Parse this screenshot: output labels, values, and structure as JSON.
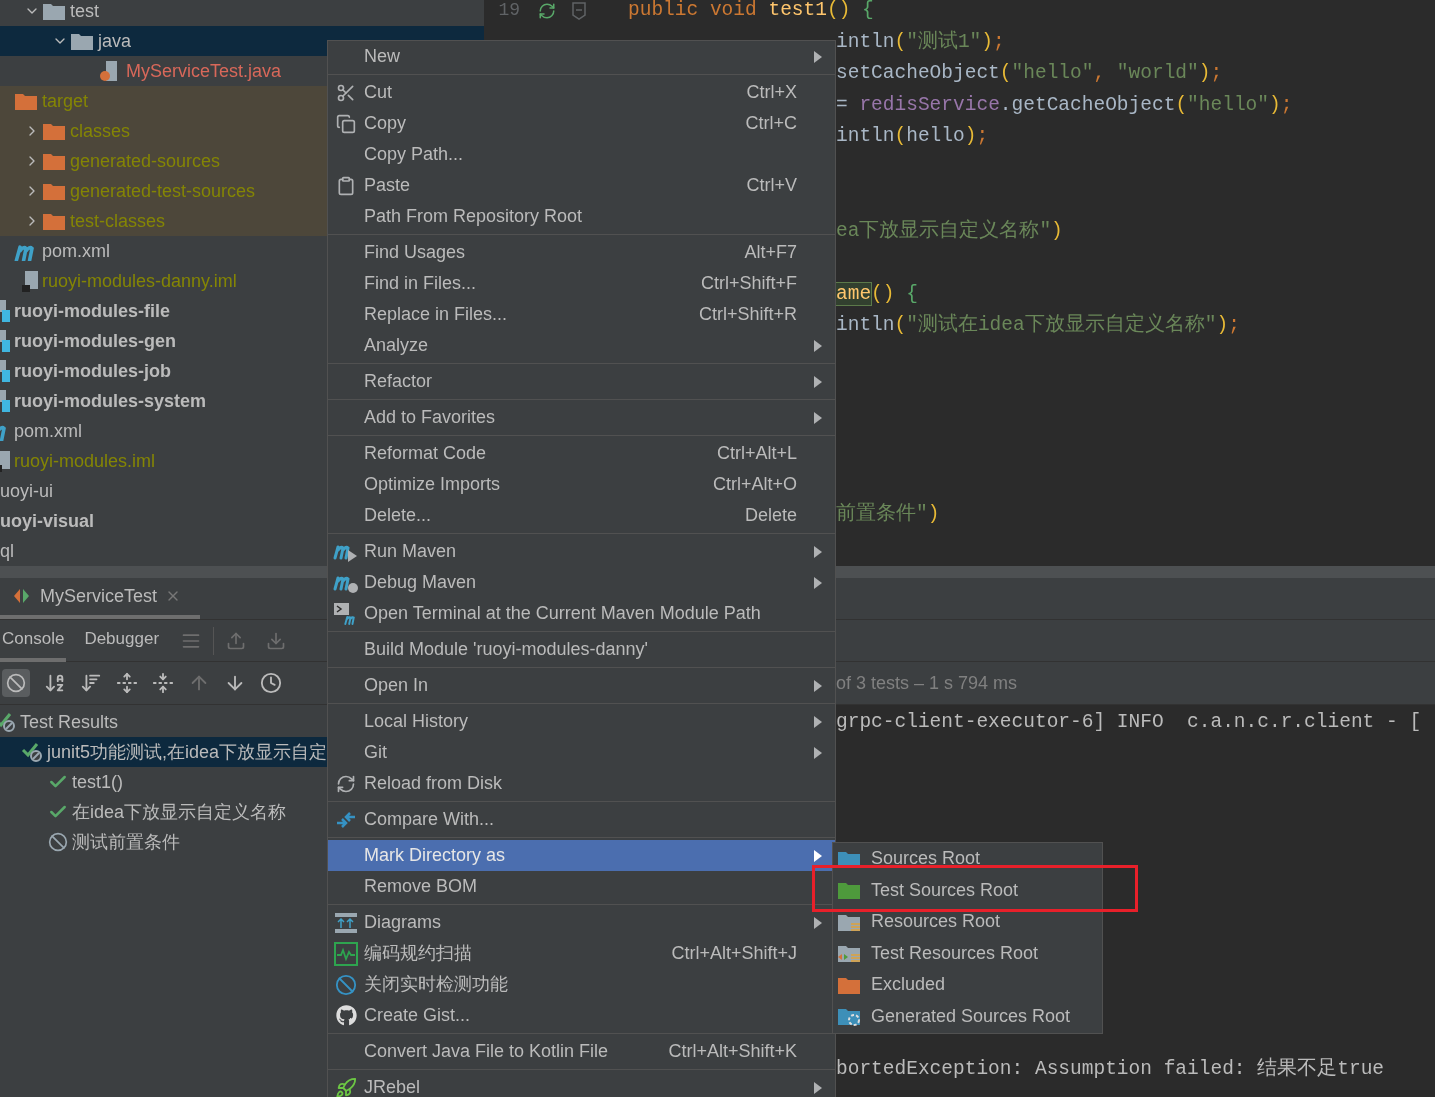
{
  "project_tree": [
    {
      "rows": [
        {
          "label": "test",
          "kind": "folder",
          "expanded": true,
          "selected": false,
          "children": [
            {
              "label": "java",
              "kind": "folder",
              "expanded": true,
              "selected": true,
              "children": [
                {
                  "label": "MyServiceTest.java",
                  "kind": "java-file",
                  "selected": false,
                  "color": "#d8685a"
                }
              ]
            }
          ]
        }
      ]
    },
    {
      "rows": [
        {
          "label": "target",
          "kind": "excluded-folder",
          "selected": false,
          "color": "#848504",
          "children": [
            {
              "label": "classes",
              "kind": "excluded-folder",
              "expanded": false,
              "selected": false,
              "color": "#848504"
            },
            {
              "label": "generated-sources",
              "kind": "excluded-folder",
              "expanded": false,
              "selected": false,
              "color": "#848504"
            },
            {
              "label": "generated-test-sources",
              "kind": "excluded-folder",
              "expanded": false,
              "selected": false,
              "color": "#848504"
            },
            {
              "label": "test-classes",
              "kind": "excluded-folder",
              "expanded": false,
              "selected": false,
              "color": "#848504"
            }
          ]
        },
        {
          "label": "pom.xml",
          "kind": "maven-file",
          "selected": false
        },
        {
          "label": "ruoyi-modules-danny.iml",
          "kind": "module-file",
          "selected": false,
          "color": "#848504"
        }
      ]
    },
    {
      "rows": [
        {
          "label": "ruoyi-modules-file",
          "kind": "module",
          "selected": false
        },
        {
          "label": "ruoyi-modules-gen",
          "kind": "module",
          "selected": false
        },
        {
          "label": "ruoyi-modules-job",
          "kind": "module",
          "selected": false
        },
        {
          "label": "ruoyi-modules-system",
          "kind": "module",
          "selected": false
        },
        {
          "label": "pom.xml",
          "kind": "maven-file",
          "selected": false
        },
        {
          "label": "ruoyi-modules.iml",
          "kind": "module-file",
          "selected": false,
          "color": "#848504"
        }
      ]
    },
    {
      "rows": [
        {
          "label": "uoyi-ui",
          "kind": "plain",
          "selected": false
        },
        {
          "label": "uoyi-visual",
          "kind": "module",
          "selected": false
        },
        {
          "label": "ql",
          "kind": "plain",
          "selected": false
        }
      ]
    }
  ],
  "editor": {
    "lines": [
      {
        "number": "19",
        "segments": [
          {
            "text": "public void ",
            "kind": "keyword"
          },
          {
            "text": "test1",
            "kind": "method"
          },
          {
            "text": "() ",
            "kind": "bracket"
          },
          {
            "text": "{",
            "kind": "brace"
          }
        ]
      },
      {
        "segments": [
          {
            "text": "intln",
            "kind": "plain"
          },
          {
            "text": "(",
            "kind": "bracket"
          },
          {
            "text": "\"测试1\"",
            "kind": "string"
          },
          {
            "text": ")",
            "kind": "bracket"
          },
          {
            "text": ";",
            "kind": "keyword"
          }
        ]
      },
      {
        "segments": [
          {
            "text": "setCacheObject",
            "kind": "plain"
          },
          {
            "text": "(",
            "kind": "bracket"
          },
          {
            "text": "\"hello\"",
            "kind": "string"
          },
          {
            "text": ", ",
            "kind": "keyword"
          },
          {
            "text": "\"world\"",
            "kind": "string"
          },
          {
            "text": ")",
            "kind": "bracket"
          },
          {
            "text": ";",
            "kind": "keyword"
          }
        ]
      },
      {
        "segments": [
          {
            "text": "= ",
            "kind": "plain"
          },
          {
            "text": "redisService",
            "kind": "field"
          },
          {
            "text": ".getCacheObject",
            "kind": "plain"
          },
          {
            "text": "(",
            "kind": "bracket"
          },
          {
            "text": "\"hello\"",
            "kind": "string"
          },
          {
            "text": ")",
            "kind": "bracket"
          },
          {
            "text": ";",
            "kind": "keyword"
          }
        ]
      },
      {
        "segments": [
          {
            "text": "intln",
            "kind": "plain"
          },
          {
            "text": "(",
            "kind": "bracket"
          },
          {
            "text": "hello",
            "kind": "plain"
          },
          {
            "text": ")",
            "kind": "bracket"
          },
          {
            "text": ";",
            "kind": "keyword"
          }
        ]
      },
      {
        "kind": "blank"
      },
      {
        "kind": "blank"
      },
      {
        "segments": [
          {
            "text": "ea下放显示自定义名称\"",
            "kind": "string"
          },
          {
            "text": ")",
            "kind": "bracket"
          }
        ]
      },
      {
        "kind": "blank"
      },
      {
        "segments": [
          {
            "text": "ame",
            "kind": "highlight"
          },
          {
            "text": "() ",
            "kind": "bracket"
          },
          {
            "text": "{",
            "kind": "brace"
          }
        ]
      },
      {
        "segments": [
          {
            "text": "intln",
            "kind": "plain"
          },
          {
            "text": "(",
            "kind": "bracket"
          },
          {
            "text": "\"测试在idea下放显示自定义名称\"",
            "kind": "string"
          },
          {
            "text": ")",
            "kind": "bracket"
          },
          {
            "text": ";",
            "kind": "keyword"
          }
        ]
      },
      {
        "kind": "blank"
      },
      {
        "kind": "blank"
      },
      {
        "kind": "blank"
      },
      {
        "kind": "blank"
      },
      {
        "kind": "blank"
      },
      {
        "segments": [
          {
            "text": "前置条件\"",
            "kind": "string"
          },
          {
            "text": ")",
            "kind": "bracket"
          }
        ]
      }
    ]
  },
  "run_panel": {
    "tab": "MyServiceTest",
    "views": [
      {
        "label": "Console",
        "selected": true
      },
      {
        "label": "Debugger",
        "selected": false
      }
    ],
    "status": "of 3 tests – 1 s 794 ms",
    "test_tree": [
      {
        "label": "Test Results",
        "kind": "mixed",
        "selected": false,
        "children": [
          {
            "label": "junit5功能测试,在idea下放显示自定",
            "kind": "mixed",
            "selected": true,
            "children": [
              {
                "label": "test1()",
                "kind": "passed",
                "selected": false
              },
              {
                "label": "在idea下放显示自定义名称",
                "kind": "passed",
                "selected": false
              },
              {
                "label": "测试前置条件",
                "kind": "ignored",
                "selected": false
              }
            ]
          }
        ]
      }
    ],
    "console_lines": [
      {
        "kind": "text",
        "text": "grpc-client-executor-6] INFO  c.a.n.c.r.client - ["
      },
      {
        "kind": "blank"
      },
      {
        "kind": "blank"
      },
      {
        "kind": "blank"
      },
      {
        "kind": "blank"
      },
      {
        "kind": "blank"
      },
      {
        "kind": "blank"
      },
      {
        "kind": "blank"
      },
      {
        "kind": "blank"
      },
      {
        "kind": "blank"
      },
      {
        "kind": "blank"
      },
      {
        "kind": "text",
        "text": "bortedException: Assumption failed: 结果不足true"
      }
    ]
  },
  "context_menu": [
    {
      "kind": "item",
      "label": "New",
      "submenu": true,
      "selected": false
    },
    {
      "kind": "separator"
    },
    {
      "kind": "item",
      "label": "Cut",
      "shortcut": "Ctrl+X",
      "submenu": false,
      "selected": false
    },
    {
      "kind": "item",
      "label": "Copy",
      "shortcut": "Ctrl+C",
      "submenu": false,
      "selected": false
    },
    {
      "kind": "item",
      "label": "Copy Path...",
      "submenu": false,
      "selected": false
    },
    {
      "kind": "item",
      "label": "Paste",
      "shortcut": "Ctrl+V",
      "submenu": false,
      "selected": false
    },
    {
      "kind": "item",
      "label": "Path From Repository Root",
      "submenu": false,
      "selected": false
    },
    {
      "kind": "separator"
    },
    {
      "kind": "item",
      "label": "Find Usages",
      "shortcut": "Alt+F7",
      "submenu": false,
      "selected": false
    },
    {
      "kind": "item",
      "label": "Find in Files...",
      "shortcut": "Ctrl+Shift+F",
      "submenu": false,
      "selected": false
    },
    {
      "kind": "item",
      "label": "Replace in Files...",
      "shortcut": "Ctrl+Shift+R",
      "submenu": false,
      "selected": false
    },
    {
      "kind": "item",
      "label": "Analyze",
      "submenu": true,
      "selected": false
    },
    {
      "kind": "separator"
    },
    {
      "kind": "item",
      "label": "Refactor",
      "submenu": true,
      "selected": false
    },
    {
      "kind": "separator"
    },
    {
      "kind": "item",
      "label": "Add to Favorites",
      "submenu": true,
      "selected": false
    },
    {
      "kind": "separator"
    },
    {
      "kind": "item",
      "label": "Reformat Code",
      "shortcut": "Ctrl+Alt+L",
      "submenu": false,
      "selected": false
    },
    {
      "kind": "item",
      "label": "Optimize Imports",
      "shortcut": "Ctrl+Alt+O",
      "submenu": false,
      "selected": false
    },
    {
      "kind": "item",
      "label": "Delete...",
      "shortcut": "Delete",
      "submenu": false,
      "selected": false
    },
    {
      "kind": "separator"
    },
    {
      "kind": "item",
      "label": "Run Maven",
      "submenu": true,
      "selected": false
    },
    {
      "kind": "item",
      "label": "Debug Maven",
      "submenu": true,
      "selected": false
    },
    {
      "kind": "item",
      "label": "Open Terminal at the Current Maven Module Path",
      "submenu": false,
      "selected": false
    },
    {
      "kind": "separator"
    },
    {
      "kind": "item",
      "label": "Build Module 'ruoyi-modules-danny'",
      "submenu": false,
      "selected": false
    },
    {
      "kind": "separator"
    },
    {
      "kind": "item",
      "label": "Open In",
      "submenu": true,
      "selected": false
    },
    {
      "kind": "separator"
    },
    {
      "kind": "item",
      "label": "Local History",
      "submenu": true,
      "selected": false
    },
    {
      "kind": "item",
      "label": "Git",
      "submenu": true,
      "selected": false
    },
    {
      "kind": "item",
      "label": "Reload from Disk",
      "submenu": false,
      "selected": false
    },
    {
      "kind": "separator"
    },
    {
      "kind": "item",
      "label": "Compare With...",
      "submenu": false,
      "selected": false
    },
    {
      "kind": "separator"
    },
    {
      "kind": "item",
      "label": "Mark Directory as",
      "submenu": true,
      "selected": true
    },
    {
      "kind": "item",
      "label": "Remove BOM",
      "submenu": false,
      "selected": false
    },
    {
      "kind": "separator"
    },
    {
      "kind": "item",
      "label": "Diagrams",
      "submenu": true,
      "selected": false
    },
    {
      "kind": "item",
      "label": "编码规约扫描",
      "shortcut": "Ctrl+Alt+Shift+J",
      "submenu": false,
      "selected": false
    },
    {
      "kind": "item",
      "label": "关闭实时检测功能",
      "submenu": false,
      "selected": false
    },
    {
      "kind": "item",
      "label": "Create Gist...",
      "submenu": false,
      "selected": false
    },
    {
      "kind": "separator"
    },
    {
      "kind": "item",
      "label": "Convert Java File to Kotlin File",
      "shortcut": "Ctrl+Alt+Shift+K",
      "submenu": false,
      "selected": false
    },
    {
      "kind": "separator"
    },
    {
      "kind": "item",
      "label": "JRebel",
      "submenu": true,
      "selected": false
    }
  ],
  "mark_submenu": {
    "items": [
      "Sources Root",
      "Test Sources Root",
      "Resources Root",
      "Test Resources Root",
      "Excluded",
      "Generated Sources Root"
    ],
    "highlight_frame": true
  }
}
